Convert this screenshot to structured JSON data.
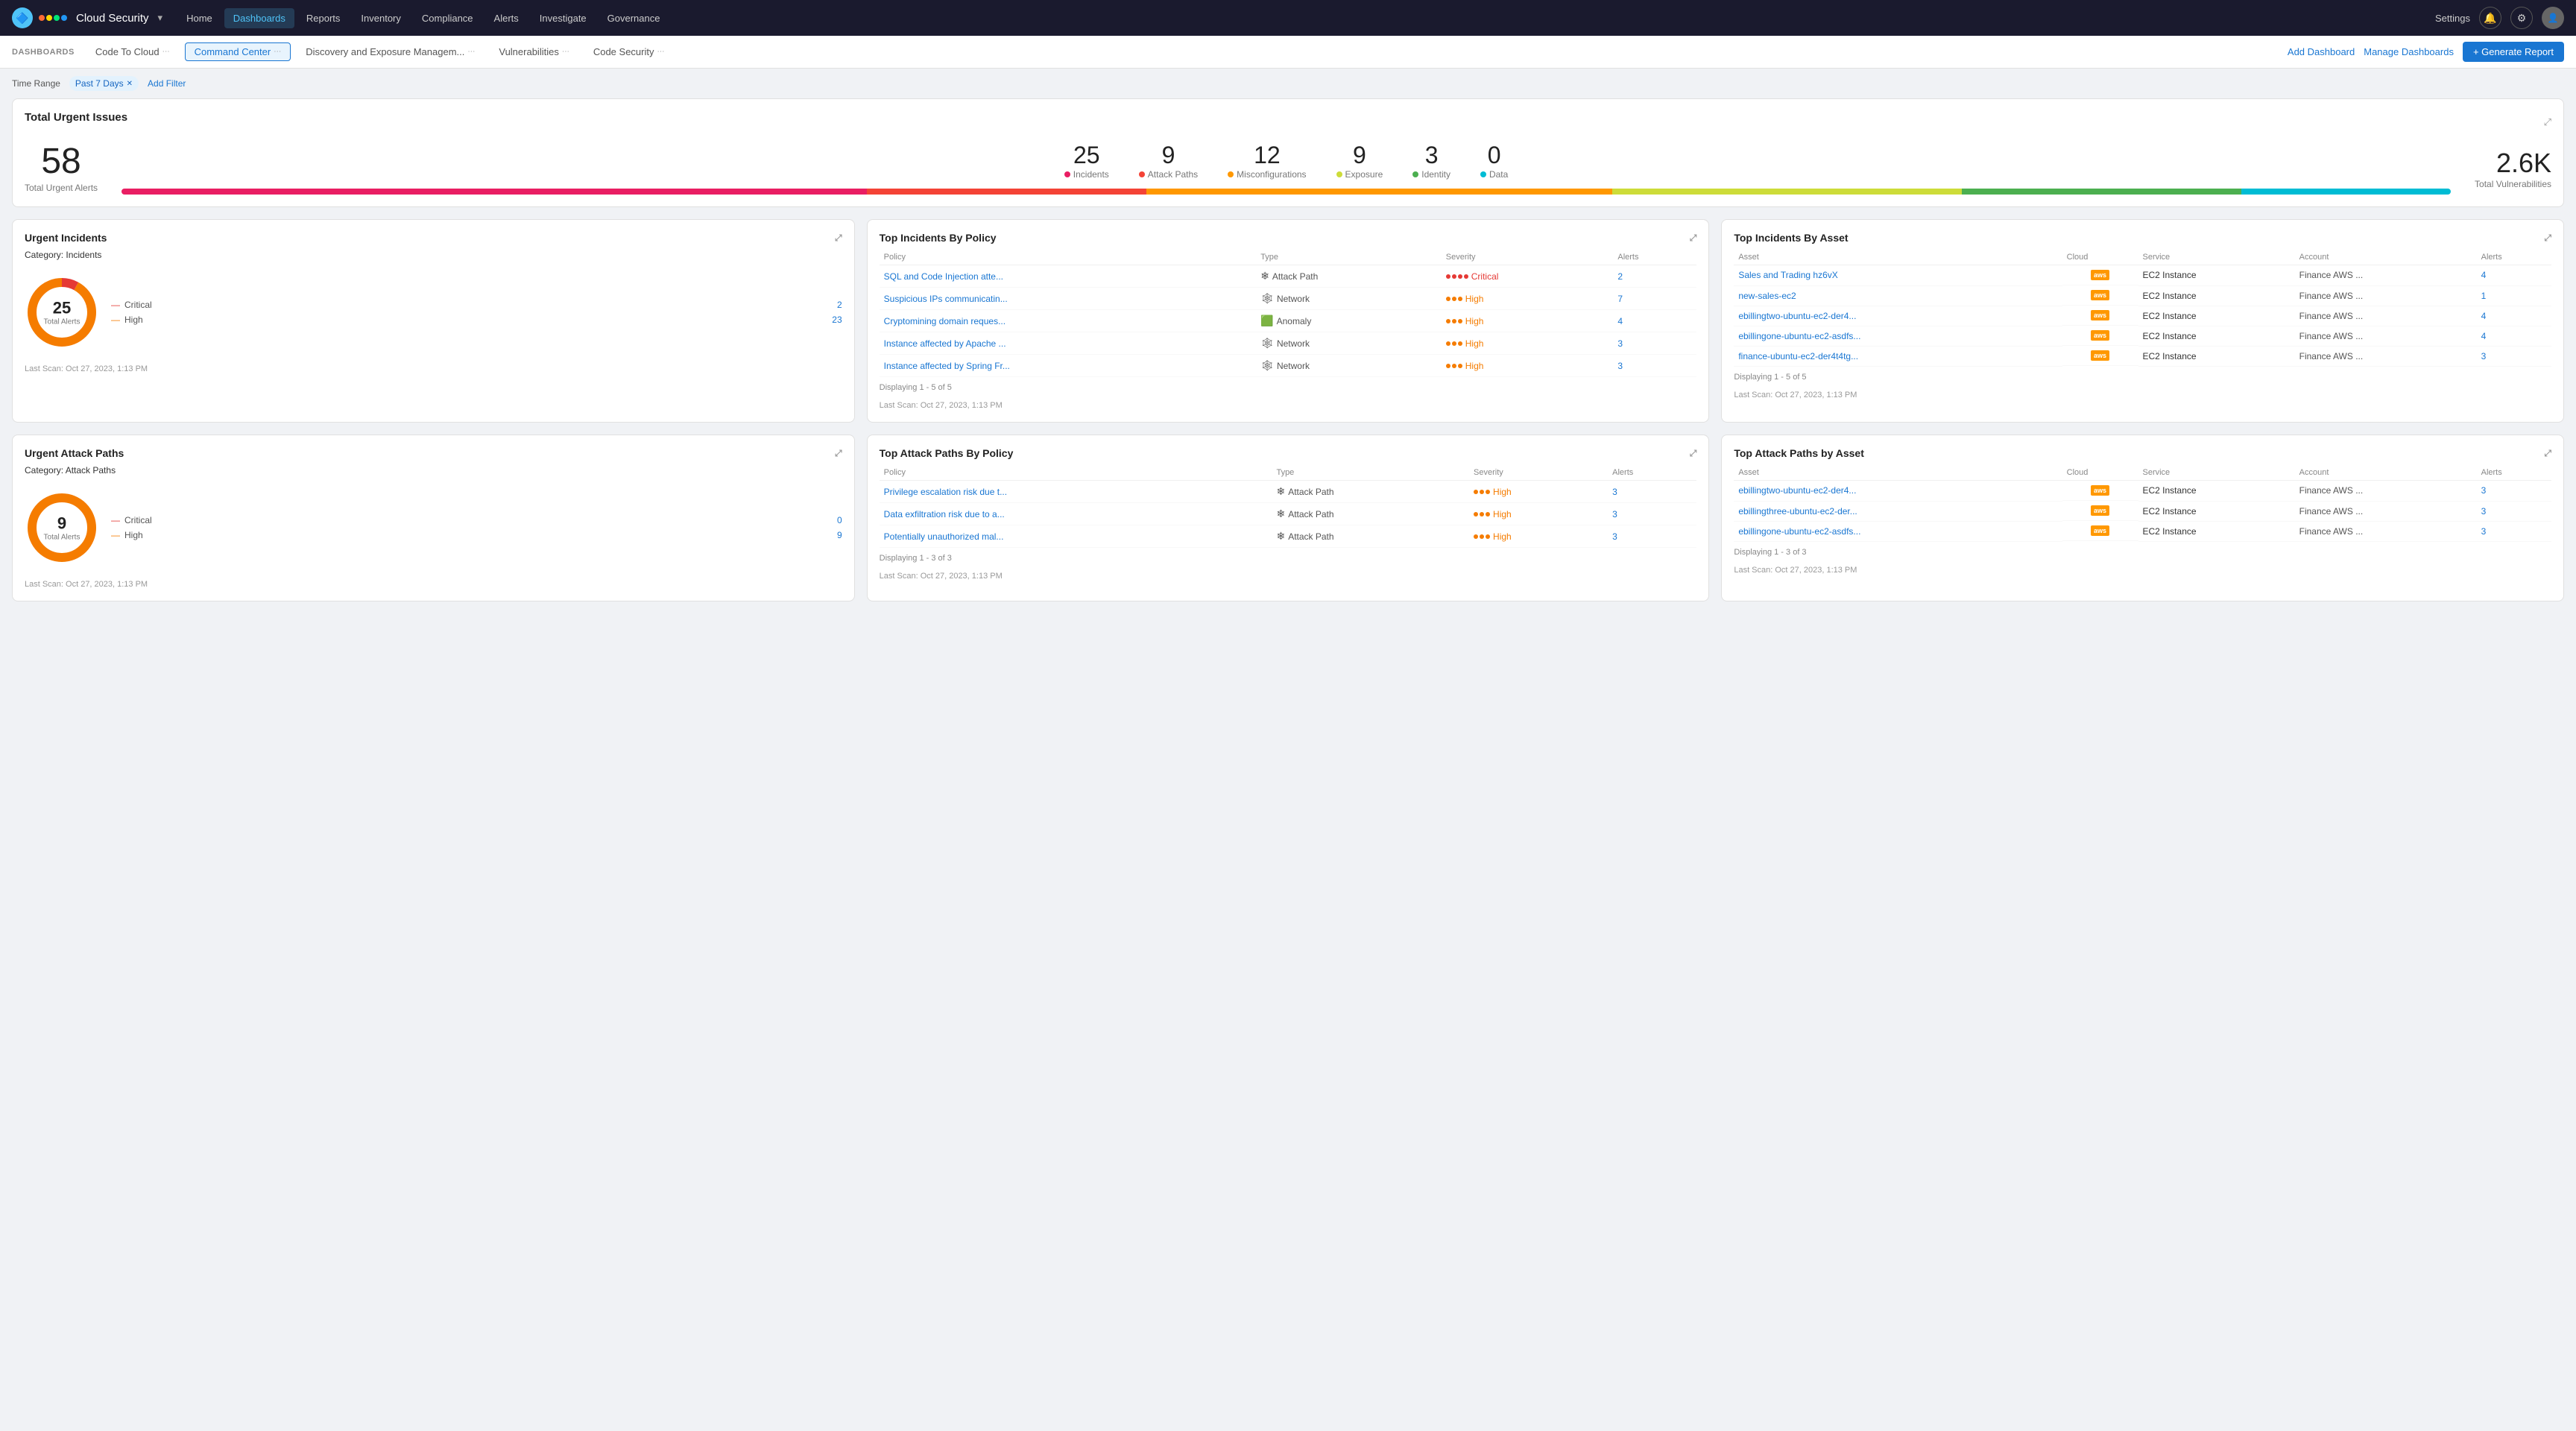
{
  "nav": {
    "logo_text": "Cloud Security",
    "items": [
      "Home",
      "Dashboards",
      "Reports",
      "Inventory",
      "Compliance",
      "Alerts",
      "Investigate",
      "Governance"
    ],
    "active_item": "Dashboards",
    "settings_label": "Settings",
    "right_icons": [
      "🔔",
      "⚙️"
    ]
  },
  "sub_nav": {
    "dashboards_label": "DASHBOARDS",
    "tabs": [
      {
        "label": "Code To Cloud",
        "active": false
      },
      {
        "label": "Command Center",
        "active": true
      },
      {
        "label": "Discovery and Exposure Managem...",
        "active": false
      },
      {
        "label": "Vulnerabilities",
        "active": false
      },
      {
        "label": "Code Security",
        "active": false
      }
    ],
    "add_dashboard": "Add Dashboard",
    "manage_dashboards": "Manage Dashboards",
    "generate_report": "+ Generate Report"
  },
  "filter": {
    "label": "Time Range",
    "chip": "Past 7 Days",
    "add_filter": "Add Filter"
  },
  "urgent_issues": {
    "title": "Total Urgent Issues",
    "total_number": "58",
    "total_label": "Total Urgent Alerts",
    "categories": [
      {
        "number": "25",
        "label": "Incidents",
        "color": "#e91e63"
      },
      {
        "number": "9",
        "label": "Attack Paths",
        "color": "#f44336"
      },
      {
        "number": "12",
        "label": "Misconfigurations",
        "color": "#ff9800"
      },
      {
        "number": "9",
        "label": "Exposure",
        "color": "#ffeb3b"
      },
      {
        "number": "3",
        "label": "Identity",
        "color": "#4caf50"
      },
      {
        "number": "0",
        "label": "Data",
        "color": "#00bcd4"
      }
    ],
    "progress_segments": [
      {
        "pct": 32,
        "color": "#e91e63"
      },
      {
        "pct": 12,
        "color": "#f44336"
      },
      {
        "pct": 20,
        "color": "#ff9800"
      },
      {
        "pct": 15,
        "color": "#ffeb3b"
      },
      {
        "pct": 12,
        "color": "#4caf50"
      },
      {
        "pct": 9,
        "color": "#00bcd4"
      }
    ],
    "vuln_number": "2.6K",
    "vuln_label": "Total Vulnerabilities"
  },
  "urgent_incidents": {
    "title": "Urgent Incidents",
    "expand_label": "⤢",
    "category_label": "Category:",
    "category_value": "Incidents",
    "total_number": "25",
    "total_label": "Total Alerts",
    "severity_rows": [
      {
        "label": "Critical",
        "value": "2"
      },
      {
        "label": "High",
        "value": "23"
      }
    ],
    "scan_time": "Last Scan: Oct 27, 2023, 1:13 PM"
  },
  "top_incidents_policy": {
    "title": "Top Incidents By Policy",
    "expand_label": "⤢",
    "columns": [
      "Policy",
      "Type",
      "Severity",
      "Alerts"
    ],
    "rows": [
      {
        "policy": "SQL and Code Injection atte...",
        "type": "Attack Path",
        "type_icon": "❄",
        "severity": "Critical",
        "alerts": "2"
      },
      {
        "policy": "Suspicious IPs communicatin...",
        "type": "Network",
        "type_icon": "🕸",
        "severity": "High",
        "alerts": "7"
      },
      {
        "policy": "Cryptomining domain reques...",
        "type": "Anomaly",
        "type_icon": "🟩",
        "severity": "High",
        "alerts": "4"
      },
      {
        "policy": "Instance affected by Apache ...",
        "type": "Network",
        "type_icon": "🕸",
        "severity": "High",
        "alerts": "3"
      },
      {
        "policy": "Instance affected by Spring Fr...",
        "type": "Network",
        "type_icon": "🕸",
        "severity": "High",
        "alerts": "3"
      }
    ],
    "displaying": "Displaying 1 - 5 of 5",
    "scan_time": "Last Scan: Oct 27, 2023, 1:13 PM"
  },
  "top_incidents_asset": {
    "title": "Top Incidents By Asset",
    "expand_label": "⤢",
    "columns": [
      "Asset",
      "Cloud",
      "Service",
      "Account",
      "Alerts"
    ],
    "rows": [
      {
        "asset": "Sales and Trading hz6vX",
        "cloud": "AWS",
        "service": "EC2 Instance",
        "account": "Finance AWS ...",
        "alerts": "4"
      },
      {
        "asset": "new-sales-ec2",
        "cloud": "AWS",
        "service": "EC2 Instance",
        "account": "Finance AWS ...",
        "alerts": "1"
      },
      {
        "asset": "ebillingtwo-ubuntu-ec2-der4...",
        "cloud": "AWS",
        "service": "EC2 Instance",
        "account": "Finance AWS ...",
        "alerts": "4"
      },
      {
        "asset": "ebillingone-ubuntu-ec2-asdf s...",
        "cloud": "AWS",
        "service": "EC2 Instance",
        "account": "Finance AWS ...",
        "alerts": "4"
      },
      {
        "asset": "finance-ubuntu-ec2-der4t4tg...",
        "cloud": "AWS",
        "service": "EC2 Instance",
        "account": "Finance AWS ...",
        "alerts": "3"
      }
    ],
    "displaying": "Displaying 1 - 5 of 5",
    "scan_time": "Last Scan: Oct 27, 2023, 1:13 PM"
  },
  "urgent_attack_paths": {
    "title": "Urgent Attack Paths",
    "expand_label": "⤢",
    "category_label": "Category:",
    "category_value": "Attack Paths",
    "total_number": "9",
    "total_label": "Total Alerts",
    "severity_rows": [
      {
        "label": "Critical",
        "value": "0"
      },
      {
        "label": "High",
        "value": "9"
      }
    ],
    "scan_time": "Last Scan: Oct 27, 2023, 1:13 PM"
  },
  "top_attack_paths_policy": {
    "title": "Top Attack Paths By Policy",
    "expand_label": "⤢",
    "columns": [
      "Policy",
      "Type",
      "Severity",
      "Alerts"
    ],
    "rows": [
      {
        "policy": "Privilege escalation risk due t...",
        "type": "Attack Path",
        "type_icon": "❄",
        "severity": "High",
        "alerts": "3"
      },
      {
        "policy": "Data exfiltration risk due to a...",
        "type": "Attack Path",
        "type_icon": "❄",
        "severity": "High",
        "alerts": "3"
      },
      {
        "policy": "Potentially unauthorized mal...",
        "type": "Attack Path",
        "type_icon": "❄",
        "severity": "High",
        "alerts": "3"
      }
    ],
    "displaying": "Displaying 1 - 3 of 3",
    "scan_time": "Last Scan: Oct 27, 2023, 1:13 PM"
  },
  "top_attack_paths_asset": {
    "title": "Top Attack Paths by Asset",
    "expand_label": "⤢",
    "columns": [
      "Asset",
      "Cloud",
      "Service",
      "Account",
      "Alerts"
    ],
    "rows": [
      {
        "asset": "ebillingtwo-ubuntu-ec2-der4...",
        "cloud": "AWS",
        "service": "EC2 Instance",
        "account": "Finance AWS ...",
        "alerts": "3"
      },
      {
        "asset": "ebillingthree-ubuntu-ec2-der...",
        "cloud": "AWS",
        "service": "EC2 Instance",
        "account": "Finance AWS ...",
        "alerts": "3"
      },
      {
        "asset": "ebillingone-ubuntu-ec2-asdfs...",
        "cloud": "AWS",
        "service": "EC2 Instance",
        "account": "Finance AWS ...",
        "alerts": "3"
      }
    ],
    "displaying": "Displaying 1 - 3 of 3",
    "scan_time": "Last Scan: Oct 27, 2023, 1:13 PM"
  },
  "colors": {
    "primary": "#1976d2",
    "critical": "#e53935",
    "high": "#f57c00",
    "incidents": "#e91e63",
    "attack_paths": "#f44336"
  }
}
